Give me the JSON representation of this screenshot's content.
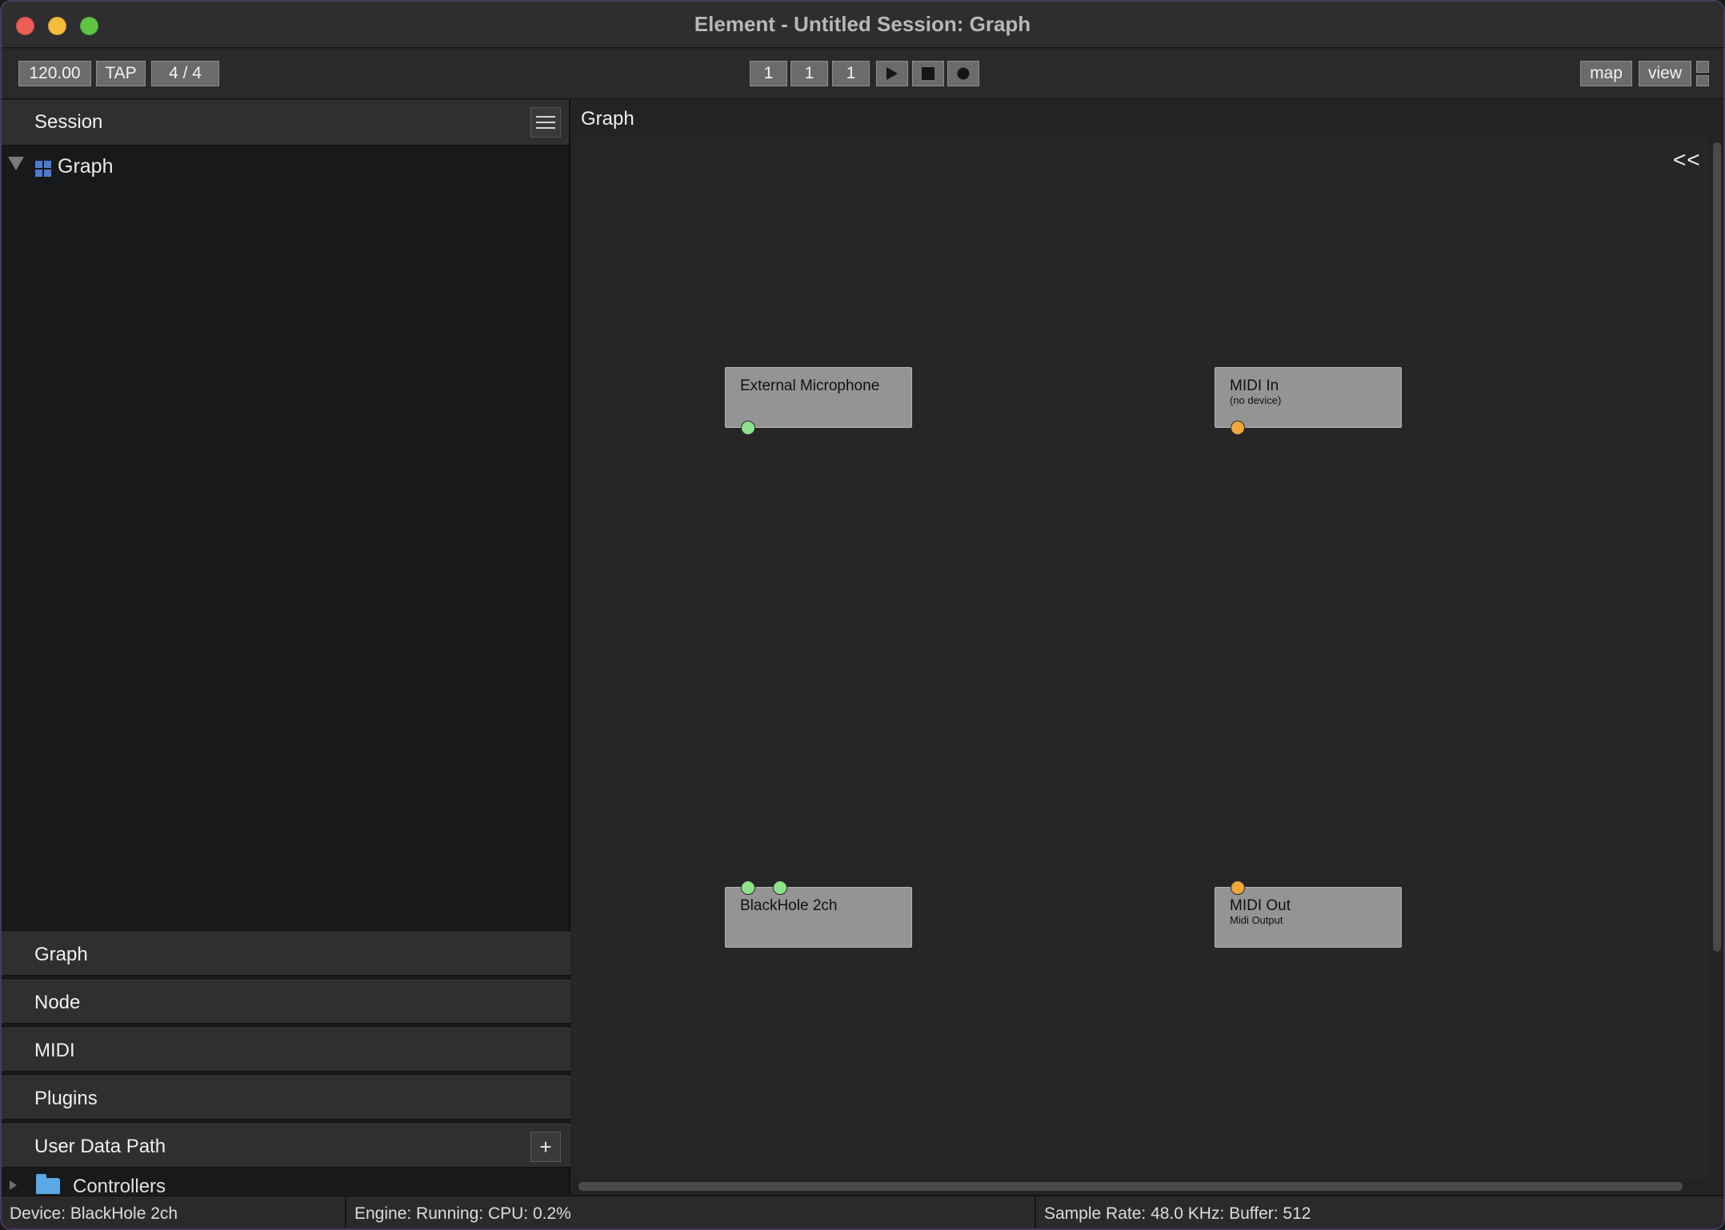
{
  "window": {
    "title": "Element - Untitled Session: Graph"
  },
  "toolbar": {
    "tempo": "120.00",
    "tap_label": "TAP",
    "time_signature": "4 / 4",
    "bar": "1",
    "beat": "1",
    "tick": "1",
    "map_label": "map",
    "view_label": "view"
  },
  "session": {
    "title": "Session",
    "tree_root": "Graph"
  },
  "sections": [
    {
      "label": "Graph"
    },
    {
      "label": "Node"
    },
    {
      "label": "MIDI"
    },
    {
      "label": "Plugins"
    },
    {
      "label": "User Data Path"
    }
  ],
  "user_data": {
    "folder": "Controllers"
  },
  "graph": {
    "title": "Graph",
    "collapse_label": "<<",
    "nodes": [
      {
        "name": "External Microphone",
        "subtitle": ""
      },
      {
        "name": "MIDI In",
        "subtitle": "(no device)"
      },
      {
        "name": "BlackHole 2ch",
        "subtitle": ""
      },
      {
        "name": "MIDI Out",
        "subtitle": "Midi Output"
      }
    ]
  },
  "status": {
    "device": "Device: BlackHole 2ch",
    "engine": "Engine: Running:  CPU: 0.2%",
    "audio": "Sample Rate: 48.0 KHz:  Buffer: 512"
  },
  "colors": {
    "audio_port": "#8fe08a",
    "midi_port": "#f3a63a",
    "graph_icon": "#4d7bd2",
    "folder_icon": "#5aa8e4"
  }
}
